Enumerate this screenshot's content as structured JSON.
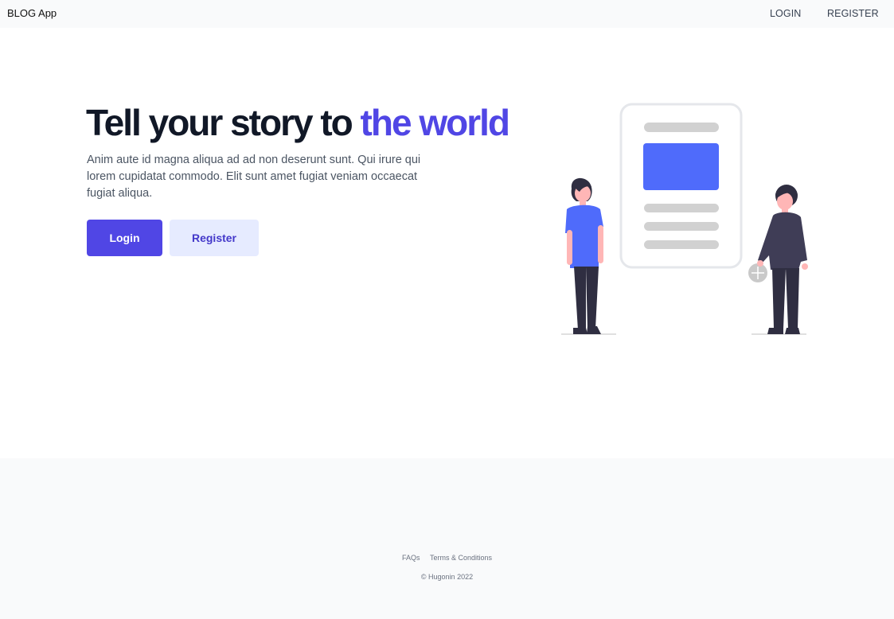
{
  "navbar": {
    "brand": "BLOG App",
    "links": [
      "LOGIN",
      "REGISTER"
    ]
  },
  "hero": {
    "title_main": "Tell your story to ",
    "title_accent": "the world",
    "description": "Anim aute id magna aliqua ad ad non deserunt sunt. Qui irure qui lorem cupidatat commodo. Elit sunt amet fugiat veniam occaecat fugiat aliqua.",
    "login_label": "Login",
    "register_label": "Register"
  },
  "footer": {
    "links": [
      "FAQs",
      "Terms & Conditions"
    ],
    "copyright": "© Hugonin 2022"
  },
  "colors": {
    "accent": "#5046e5",
    "secondary_button_bg": "#e6ebff",
    "illustration_blue": "#4f6bfb",
    "illustration_dark": "#2f2e41",
    "illustration_gray": "#d1d1d1"
  },
  "icons": {
    "illustration": "people-with-document-illustration"
  }
}
